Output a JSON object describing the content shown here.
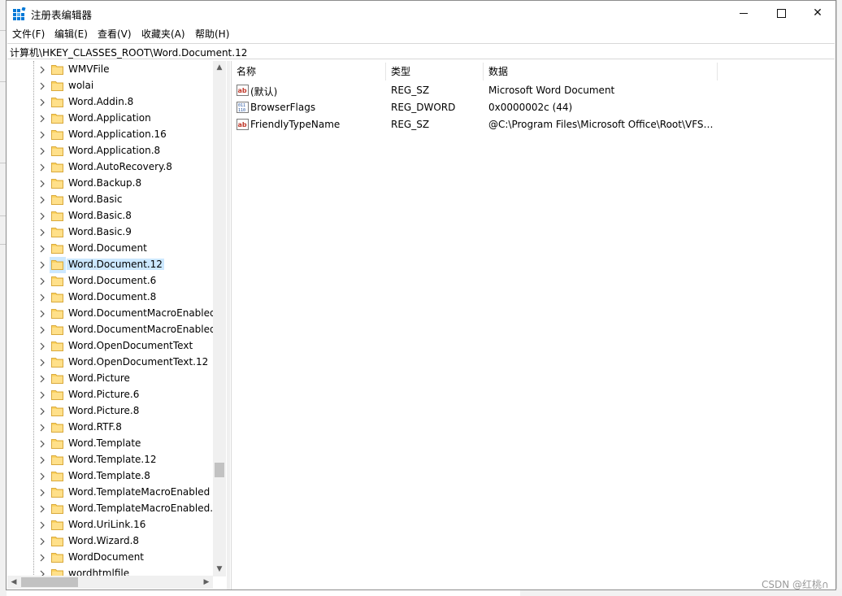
{
  "window": {
    "title": "注册表编辑器",
    "accent": "#0078d7"
  },
  "menu": [
    "文件(F)",
    "编辑(E)",
    "查看(V)",
    "收藏夹(A)",
    "帮助(H)"
  ],
  "address": "计算机\\HKEY_CLASSES_ROOT\\Word.Document.12",
  "tree": {
    "items": [
      {
        "label": "WMVFile",
        "selected": false
      },
      {
        "label": "wolai",
        "selected": false
      },
      {
        "label": "Word.Addin.8",
        "selected": false
      },
      {
        "label": "Word.Application",
        "selected": false
      },
      {
        "label": "Word.Application.16",
        "selected": false
      },
      {
        "label": "Word.Application.8",
        "selected": false
      },
      {
        "label": "Word.AutoRecovery.8",
        "selected": false
      },
      {
        "label": "Word.Backup.8",
        "selected": false
      },
      {
        "label": "Word.Basic",
        "selected": false
      },
      {
        "label": "Word.Basic.8",
        "selected": false
      },
      {
        "label": "Word.Basic.9",
        "selected": false
      },
      {
        "label": "Word.Document",
        "selected": false
      },
      {
        "label": "Word.Document.12",
        "selected": true
      },
      {
        "label": "Word.Document.6",
        "selected": false
      },
      {
        "label": "Word.Document.8",
        "selected": false
      },
      {
        "label": "Word.DocumentMacroEnabled",
        "selected": false
      },
      {
        "label": "Word.DocumentMacroEnabled",
        "selected": false
      },
      {
        "label": "Word.OpenDocumentText",
        "selected": false
      },
      {
        "label": "Word.OpenDocumentText.12",
        "selected": false
      },
      {
        "label": "Word.Picture",
        "selected": false
      },
      {
        "label": "Word.Picture.6",
        "selected": false
      },
      {
        "label": "Word.Picture.8",
        "selected": false
      },
      {
        "label": "Word.RTF.8",
        "selected": false
      },
      {
        "label": "Word.Template",
        "selected": false
      },
      {
        "label": "Word.Template.12",
        "selected": false
      },
      {
        "label": "Word.Template.8",
        "selected": false
      },
      {
        "label": "Word.TemplateMacroEnabled",
        "selected": false
      },
      {
        "label": "Word.TemplateMacroEnabled.",
        "selected": false
      },
      {
        "label": "Word.UriLink.16",
        "selected": false
      },
      {
        "label": "Word.Wizard.8",
        "selected": false
      },
      {
        "label": "WordDocument",
        "selected": false
      },
      {
        "label": "wordhtmlfile",
        "selected": false
      }
    ]
  },
  "values": {
    "columns": {
      "name": "名称",
      "type": "类型",
      "data": "数据"
    },
    "rows": [
      {
        "icon": "string-value-icon",
        "name": "(默认)",
        "type": "REG_SZ",
        "data": "Microsoft Word Document"
      },
      {
        "icon": "binary-value-icon",
        "name": "BrowserFlags",
        "type": "REG_DWORD",
        "data": "0x0000002c (44)"
      },
      {
        "icon": "string-value-icon",
        "name": "FriendlyTypeName",
        "type": "REG_SZ",
        "data": "@C:\\Program Files\\Microsoft Office\\Root\\VFS…"
      }
    ]
  },
  "watermark": "CSDN @红桃∩"
}
